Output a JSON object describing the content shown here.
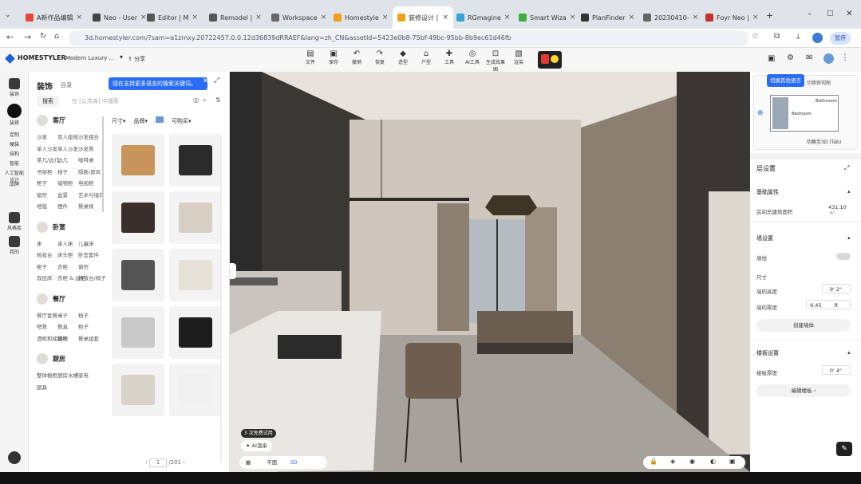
{
  "browser": {
    "tabs": [
      {
        "label": "A新作品编辑",
        "active": false,
        "color": "#e8453c"
      },
      {
        "label": "Neo - User",
        "active": false,
        "color": "#444"
      },
      {
        "label": "Editor | M",
        "active": false,
        "color": "#555"
      },
      {
        "label": "Remodel | ",
        "active": false,
        "color": "#555"
      },
      {
        "label": "Workspace",
        "active": false,
        "color": "#666"
      },
      {
        "label": "Homestyle",
        "active": false,
        "color": "#f2a01c"
      },
      {
        "label": "装修设计 (",
        "active": true,
        "color": "#f2a01c"
      },
      {
        "label": "RGmagine",
        "active": false,
        "color": "#35a3d4"
      },
      {
        "label": "Smart Wiza",
        "active": false,
        "color": "#3fae3f"
      },
      {
        "label": "PlanFinder",
        "active": false,
        "color": "#333"
      },
      {
        "label": "20230410-",
        "active": false,
        "color": "#666"
      },
      {
        "label": "Foyr Neo |",
        "active": false,
        "color": "#c9302c"
      }
    ],
    "url": "3d.homestyler.com/?sam=a1zmxy.20722457.0.0.12d36839dRRAEF&lang=zh_CN&assetId=5423e0b8-75bf-49bc-95bb-8b9ec61d46fb",
    "profile_label": "暂停"
  },
  "app": {
    "brand": "HOMESTYLER",
    "project": "Modern Luxury ...",
    "share": "分享",
    "toolbar": [
      "文件",
      "保存",
      "撤销",
      "恢复",
      "造型",
      "户型",
      "工具",
      "AI工具",
      "生成效果图",
      "渲染"
    ],
    "tooltip_lang": "现在支持更多语言的搜索关键词。",
    "tooltip_switch": "切换其他语言"
  },
  "rail": {
    "items": [
      "装饰",
      "装修",
      "定制",
      "硬装",
      "结构",
      "智能",
      "人工智能设计",
      "品牌",
      "风格库",
      "我的"
    ]
  },
  "panel": {
    "title": "装饰",
    "subtitle": "目录",
    "search_button": "搜索",
    "search_placeholder": "在 [公共库] 中搜索",
    "filters": [
      "尺寸",
      "品牌",
      "可购买"
    ],
    "categories": [
      {
        "name": "客厅",
        "items": [
          "沙发",
          "双人座椅",
          "沙发组合",
          "单人沙发",
          "单人沙发",
          "沙发凳",
          "茶几/边几",
          "边几",
          "咖啡桌",
          "书架柜",
          "椅子",
          "隔断/屏风",
          "柜子",
          "储物柜",
          "电视柜",
          "窗帘",
          "盆景",
          "艺术与墙饰",
          "地毯",
          "摆件",
          "餐桌椅"
        ]
      },
      {
        "name": "卧室",
        "items": [
          "床",
          "单人床",
          "儿童床",
          "梳妆台",
          "床头柜",
          "卧室套件",
          "柜子",
          "衣柜",
          "窗帘",
          "双层床",
          "衣柜 & 边柜",
          "梳妆台/椅子"
        ]
      },
      {
        "name": "餐厅",
        "items": [
          "餐厅套餐",
          "桌子",
          "椅子",
          "吧凳",
          "餐具",
          "柜子",
          "酒柜和储物柜",
          "窗帘",
          "餐桌组套"
        ]
      },
      {
        "name": "厨房",
        "items": [
          "整体橱柜",
          "厨房水槽",
          "家电",
          "厨具"
        ]
      }
    ],
    "page": "1",
    "page_total": "/201"
  },
  "scene": {
    "badge": "3 次免费试用",
    "ai_btn": "AI渲染",
    "view_label": "平面",
    "view_3d": "3D"
  },
  "right": {
    "minimap_label": "切换至3D (Tab)",
    "minimap_top": "切换俯视图",
    "minimap_bathroom": "Bathroom",
    "minimap_bedroom": "Bedroom",
    "section_title": "层设置",
    "base_attr": "基础属性",
    "area_label": "房间总建筑面积",
    "area_value": "431.10",
    "area_unit": "ft²",
    "wall_section": "墙设置",
    "wall_toggle": "墙线",
    "size_label": "尺寸",
    "wall_height_label": "墙的高度",
    "wall_height_value": "9' 2\"",
    "wall_thick_label": "墙的厚度",
    "wall_thick_value": "9.45",
    "wall_thick_unit": "ft",
    "wall_btn": "创建墙体",
    "floor_section": "楼板设置",
    "floor_thick_label": "楼板厚度",
    "floor_thick_value": "0' 4\"",
    "edit_floor_btn": "编辑楼板"
  },
  "colors": {
    "accent": "#2a6df4",
    "dark": "#222222",
    "brand": "#f2a01c"
  }
}
